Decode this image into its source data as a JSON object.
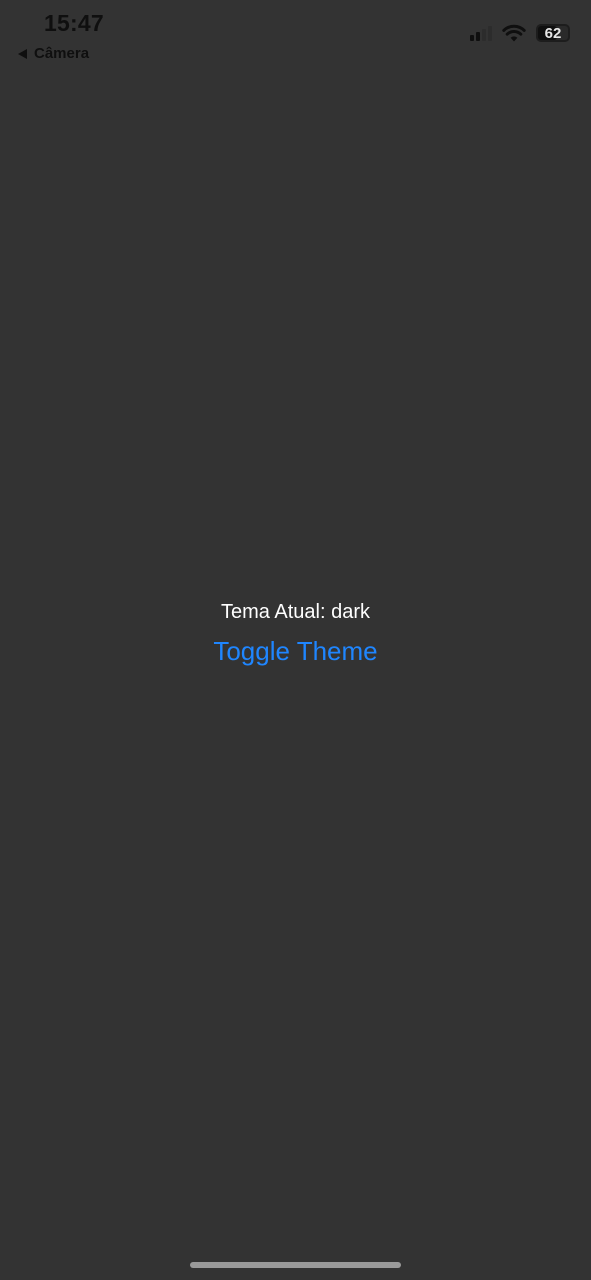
{
  "status_bar": {
    "time": "15:47",
    "back_app_label": "Câmera",
    "battery_percent": "62",
    "battery_level": 0.62,
    "icons": [
      "back-arrow-icon",
      "signal-icon",
      "wifi-icon",
      "battery-icon"
    ]
  },
  "main": {
    "theme_label": "Tema Atual: dark",
    "toggle_button_label": "Toggle Theme"
  },
  "colors": {
    "background": "#333333",
    "accent": "#1f86ff",
    "text": "#ffffff"
  }
}
